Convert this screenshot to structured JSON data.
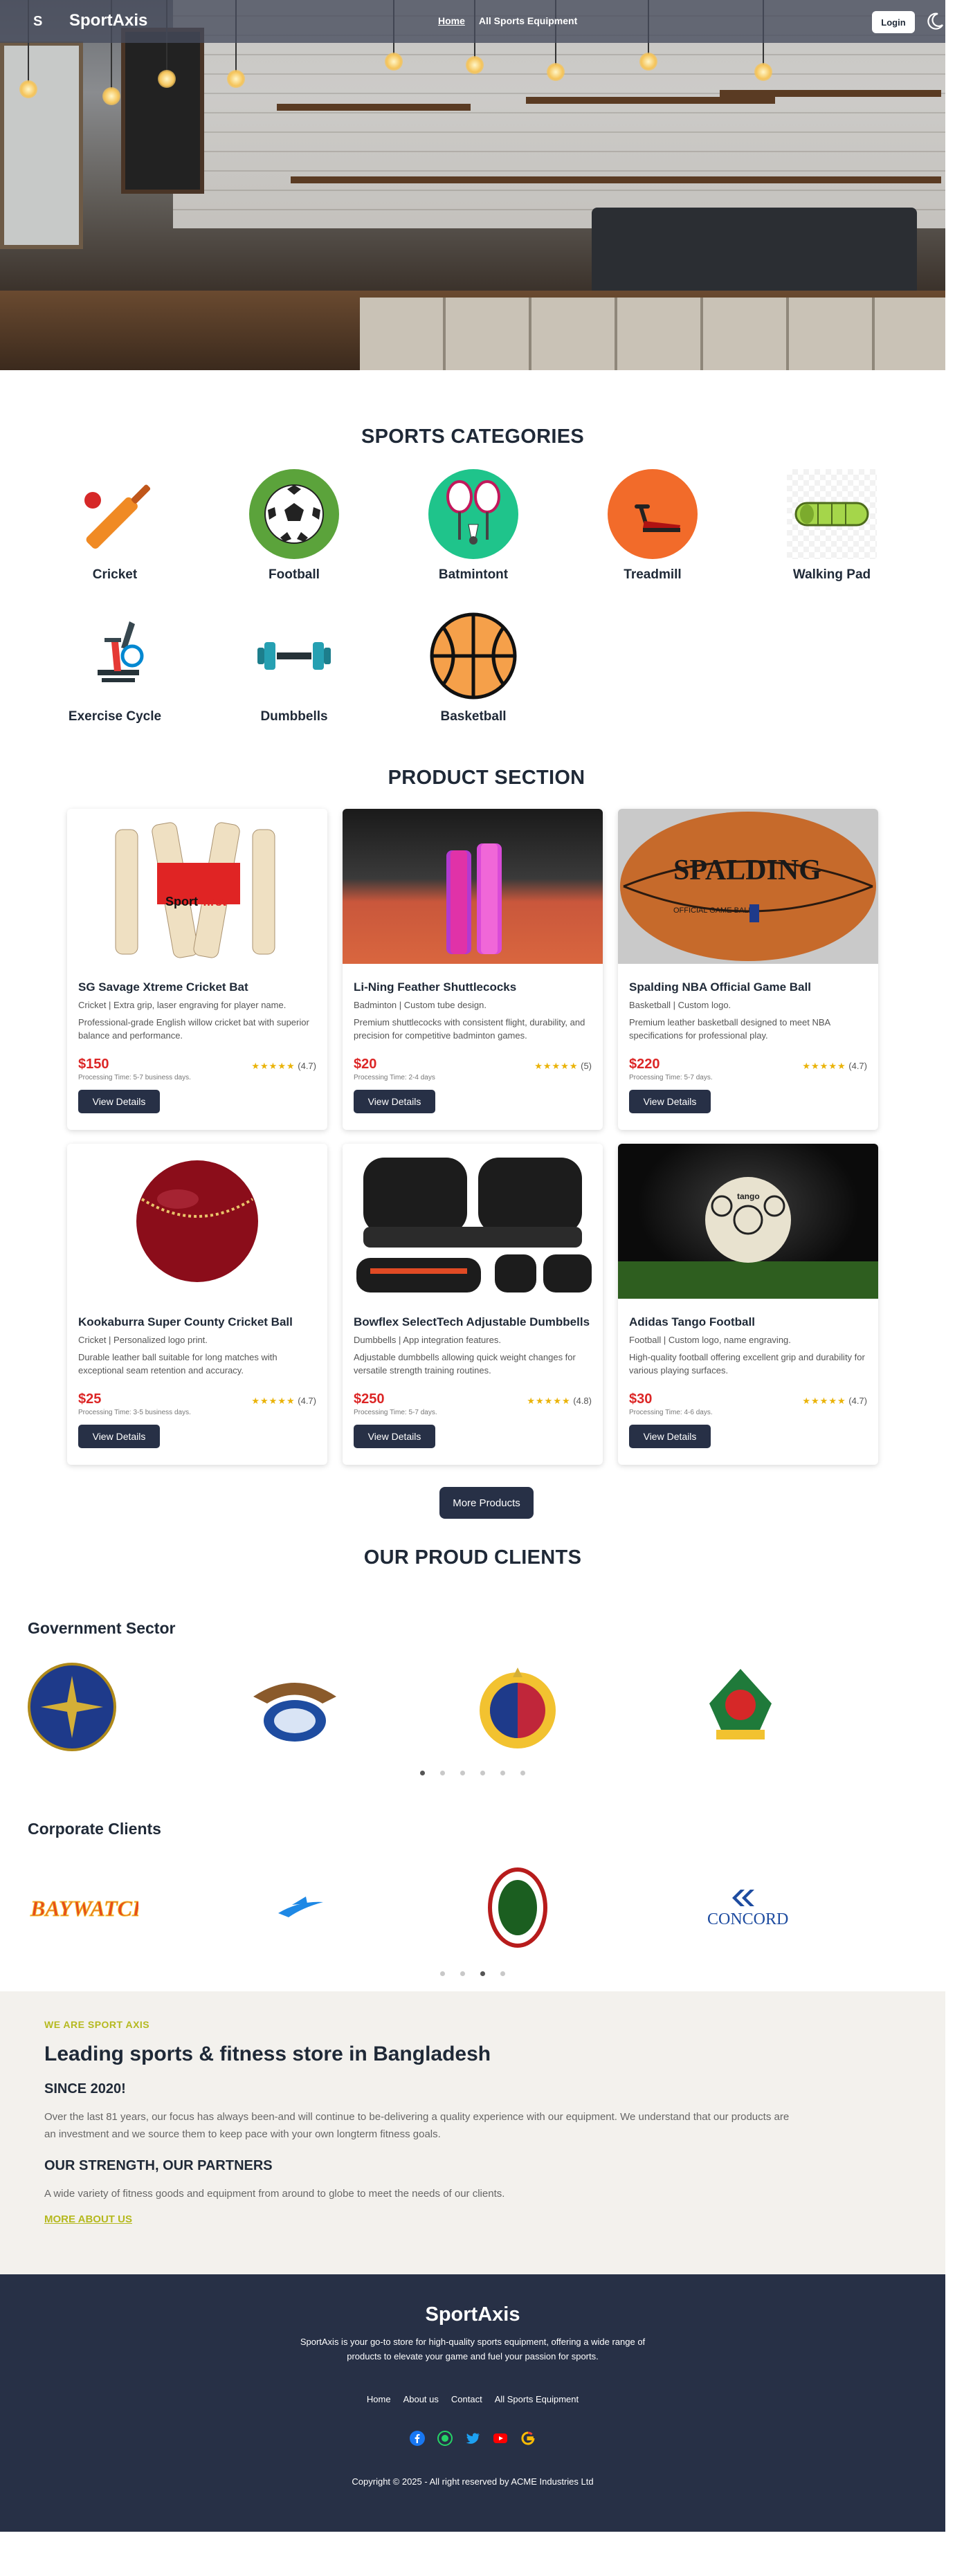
{
  "nav": {
    "hamburger": "S",
    "brand": "SportAxis",
    "links": [
      "Home",
      "All Sports Equipment"
    ],
    "login": "Login"
  },
  "categories": {
    "title": "SPORTS CATEGORIES",
    "items": [
      "Cricket",
      "Football",
      "Batmintont",
      "Treadmill",
      "Walking Pad",
      "Exercise Cycle",
      "Dumbbells",
      "Basketball"
    ]
  },
  "products": {
    "title": "PRODUCT SECTION",
    "items": [
      {
        "name": "SG Savage Xtreme Cricket Bat",
        "sub": "Cricket | Extra grip, laser engraving for player name.",
        "desc": "Professional-grade English willow cricket bat with superior balance and performance.",
        "price": "$150",
        "time": "Processing Time: 5-7 business days.",
        "rating": 4.7,
        "rating_text": "(4.7)",
        "button": "View Details"
      },
      {
        "name": "Li-Ning Feather Shuttlecocks",
        "sub": "Badminton | Custom tube design.",
        "desc": "Premium shuttlecocks with consistent flight, durability, and precision for competitive badminton games.",
        "price": "$20",
        "time": "Processing Time: 2-4 days",
        "rating": 5,
        "rating_text": "(5)",
        "button": "View Details"
      },
      {
        "name": "Spalding NBA Official Game Ball",
        "sub": "Basketball | Custom logo.",
        "desc": "Premium leather basketball designed to meet NBA specifications for professional play.",
        "price": "$220",
        "time": "Processing Time: 5-7 days.",
        "rating": 4.7,
        "rating_text": "(4.7)",
        "button": "View Details"
      },
      {
        "name": "Kookaburra Super County Cricket Ball",
        "sub": "Cricket | Personalized logo print.",
        "desc": "Durable leather ball suitable for long matches with exceptional seam retention and accuracy.",
        "price": "$25",
        "time": "Processing Time: 3-5 business days.",
        "rating": 4.7,
        "rating_text": "(4.7)",
        "button": "View Details"
      },
      {
        "name": "Bowflex SelectTech Adjustable Dumbbells",
        "sub": "Dumbbells | App integration features.",
        "desc": "Adjustable dumbbells allowing quick weight changes for versatile strength training routines.",
        "price": "$250",
        "time": "Processing Time: 5-7 days.",
        "rating": 4.8,
        "rating_text": "(4.8)",
        "button": "View Details"
      },
      {
        "name": "Adidas Tango Football",
        "sub": "Football | Custom logo, name engraving.",
        "desc": "High-quality football offering excellent grip and durability for various playing surfaces.",
        "price": "$30",
        "time": "Processing Time: 4-6 days.",
        "rating": 4.7,
        "rating_text": "(4.7)",
        "button": "View Details"
      }
    ],
    "more": "More Products"
  },
  "product_image_text": {
    "bat_logo": "Sport",
    "bat_logo2": "first",
    "ball_brand": "SPALDING",
    "ball_official": "OFFICIAL GAME BALL",
    "football_brand": "tango"
  },
  "clients": {
    "title": "OUR PROUD CLIENTS",
    "government_title": "Government Sector",
    "corporate_title": "Corporate Clients",
    "gov_dots": 6,
    "gov_active": 0,
    "corp_dots": 4,
    "corp_active": 2,
    "corporate_logo_text": {
      "baywatch": "BAYWATCH",
      "concord": "CONCORD"
    }
  },
  "about": {
    "eyebrow": "WE ARE SPORT AXIS",
    "heading": "Leading sports & fitness store in Bangladesh",
    "since": "SINCE 2020!",
    "since_text": "Over the last 81 years, our focus has always been-and will continue to be-delivering a quality experience with our equipment. We understand that our products are an investment and we source them to keep pace with your own longterm fitness goals.",
    "strength": "OUR STRENGTH, OUR PARTNERS",
    "strength_text": "A wide variety of fitness goods and equipment from around to globe to meet the needs of our clients.",
    "link": "MORE ABOUT US"
  },
  "footer": {
    "brand": "SportAxis",
    "tagline": "SportAxis is your go-to store for high-quality sports equipment, offering a wide range of products to elevate your game and fuel your passion for sports.",
    "links": [
      "Home",
      "About us",
      "Contact",
      "All Sports Equipment"
    ],
    "social_icons": [
      "facebook-icon",
      "whatsapp-icon",
      "twitter-icon",
      "youtube-icon",
      "google-icon"
    ],
    "copyright": "Copyright © 2025 - All right reserved by ACME Industries Ltd"
  },
  "colors": {
    "navy": "#273046",
    "price": "#dc2626",
    "star": "#eab308",
    "accent": "#b5b91f"
  }
}
